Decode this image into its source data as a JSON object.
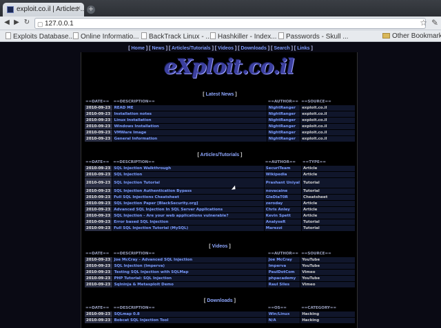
{
  "browser": {
    "tab_title": "exploit.co.il | Articles ...",
    "tab_close": "×",
    "new_tab": "+",
    "url": "127.0.0.1",
    "bookmarks": [
      "Exploits Database...",
      "Online Informatio...",
      "BackTrack Linux - ...",
      "Hashkiller - Index...",
      "Passwords - Skull ..."
    ],
    "other_bookmarks": "Other Bookmarks"
  },
  "site": {
    "logo": "eXploit.co.il",
    "topnav": [
      "Home",
      "News",
      "Articles/Tutorials",
      "Videos",
      "Downloads",
      "Search",
      "Links"
    ]
  },
  "news": {
    "title": "Latest News",
    "headers": [
      "==DATE==",
      "==DESCRIPTION==",
      "==AUTHOR==",
      "==SOURCE=="
    ],
    "rows": [
      [
        "2010-09-23",
        "READ ME",
        "NightRanger",
        "exploit.co.il"
      ],
      [
        "2010-09-23",
        "Installation notes",
        "NightRanger",
        "exploit.co.il"
      ],
      [
        "2010-09-23",
        "Linux Installation",
        "NightRanger",
        "exploit.co.il"
      ],
      [
        "2010-09-23",
        "Windows Installation",
        "NightRanger",
        "exploit.co.il"
      ],
      [
        "2010-09-23",
        "VMWare Image",
        "NightRanger",
        "exploit.co.il"
      ],
      [
        "2010-09-23",
        "General Information",
        "NightRanger",
        "exploit.co.il"
      ]
    ]
  },
  "articles": {
    "title": "Articles/Tutorials",
    "headers": [
      "==DATE==",
      "==DESCRIPTION==",
      "==AUTHOR==",
      "==TYPE=="
    ],
    "rows": [
      [
        "2010-09-23",
        "SQL Injection Walkthrough",
        "SecuriTeam",
        "Article"
      ],
      [
        "2010-09-23",
        "SQL Injection",
        "Wikipedia",
        "Article"
      ],
      [
        "2010-09-23",
        "SQL Injection Tutorial",
        "Prashant Uniyal",
        "Tutorial"
      ],
      [
        "2010-09-23",
        "SQL Injection Authentication Bypass",
        "novacaine",
        "Tutorial"
      ],
      [
        "2010-09-23",
        "Full SQL Injections Cheatsheet",
        "GleDiaT0R",
        "Cheatsheet"
      ],
      [
        "2010-09-23",
        "SQL Injection Paper [BlackSecurity.org]",
        "zeroday",
        "Article"
      ],
      [
        "2010-09-23",
        "Advanced SQL Injection In SQL Server Applications",
        "Chris Anley",
        "Article"
      ],
      [
        "2010-09-23",
        "SQL Injection - Are your web applications vulnerable?",
        "Kevin Spett",
        "Article"
      ],
      [
        "2010-09-23",
        "Error based SQL Injection",
        "AnalyseR",
        "Tutorial"
      ],
      [
        "2010-09-23",
        "Full SQL Injection Tutorial (MySQL)",
        "Marezzi",
        "Tutorial"
      ]
    ]
  },
  "videos": {
    "title": "Videos",
    "headers": [
      "==DATE==",
      "==DESCRIPTION==",
      "==AUTHOR==",
      "==SOURCE=="
    ],
    "rows": [
      [
        "2010-09-23",
        "Joe McCray - Advanced SQL Injection",
        "Joe McCray",
        "YouTube"
      ],
      [
        "2010-09-23",
        "SQL Injection (Imperva)",
        "Imperva",
        "YouTube"
      ],
      [
        "2010-09-23",
        "Testing SQL Injection with SQLMap",
        "PaulDotCom",
        "Vimeo"
      ],
      [
        "2010-09-23",
        "PHP Tutorial: SQL Injection",
        "phpacademy",
        "YouTube"
      ],
      [
        "2010-09-23",
        "Sqlninja & Metasploit Demo",
        "Raul Siles",
        "Vimeo"
      ]
    ]
  },
  "downloads": {
    "title": "Downloads",
    "headers": [
      "==DATE==",
      "==DESCRIPTION==",
      "==OS==",
      "==CATEGORY=="
    ],
    "rows": [
      [
        "2010-09-23",
        "SQLmap 0.8",
        "Win/Linux",
        "Hacking"
      ],
      [
        "2010-09-23",
        "Bobcat SQL Injection Tool",
        "N/A",
        "Hacking"
      ]
    ]
  }
}
